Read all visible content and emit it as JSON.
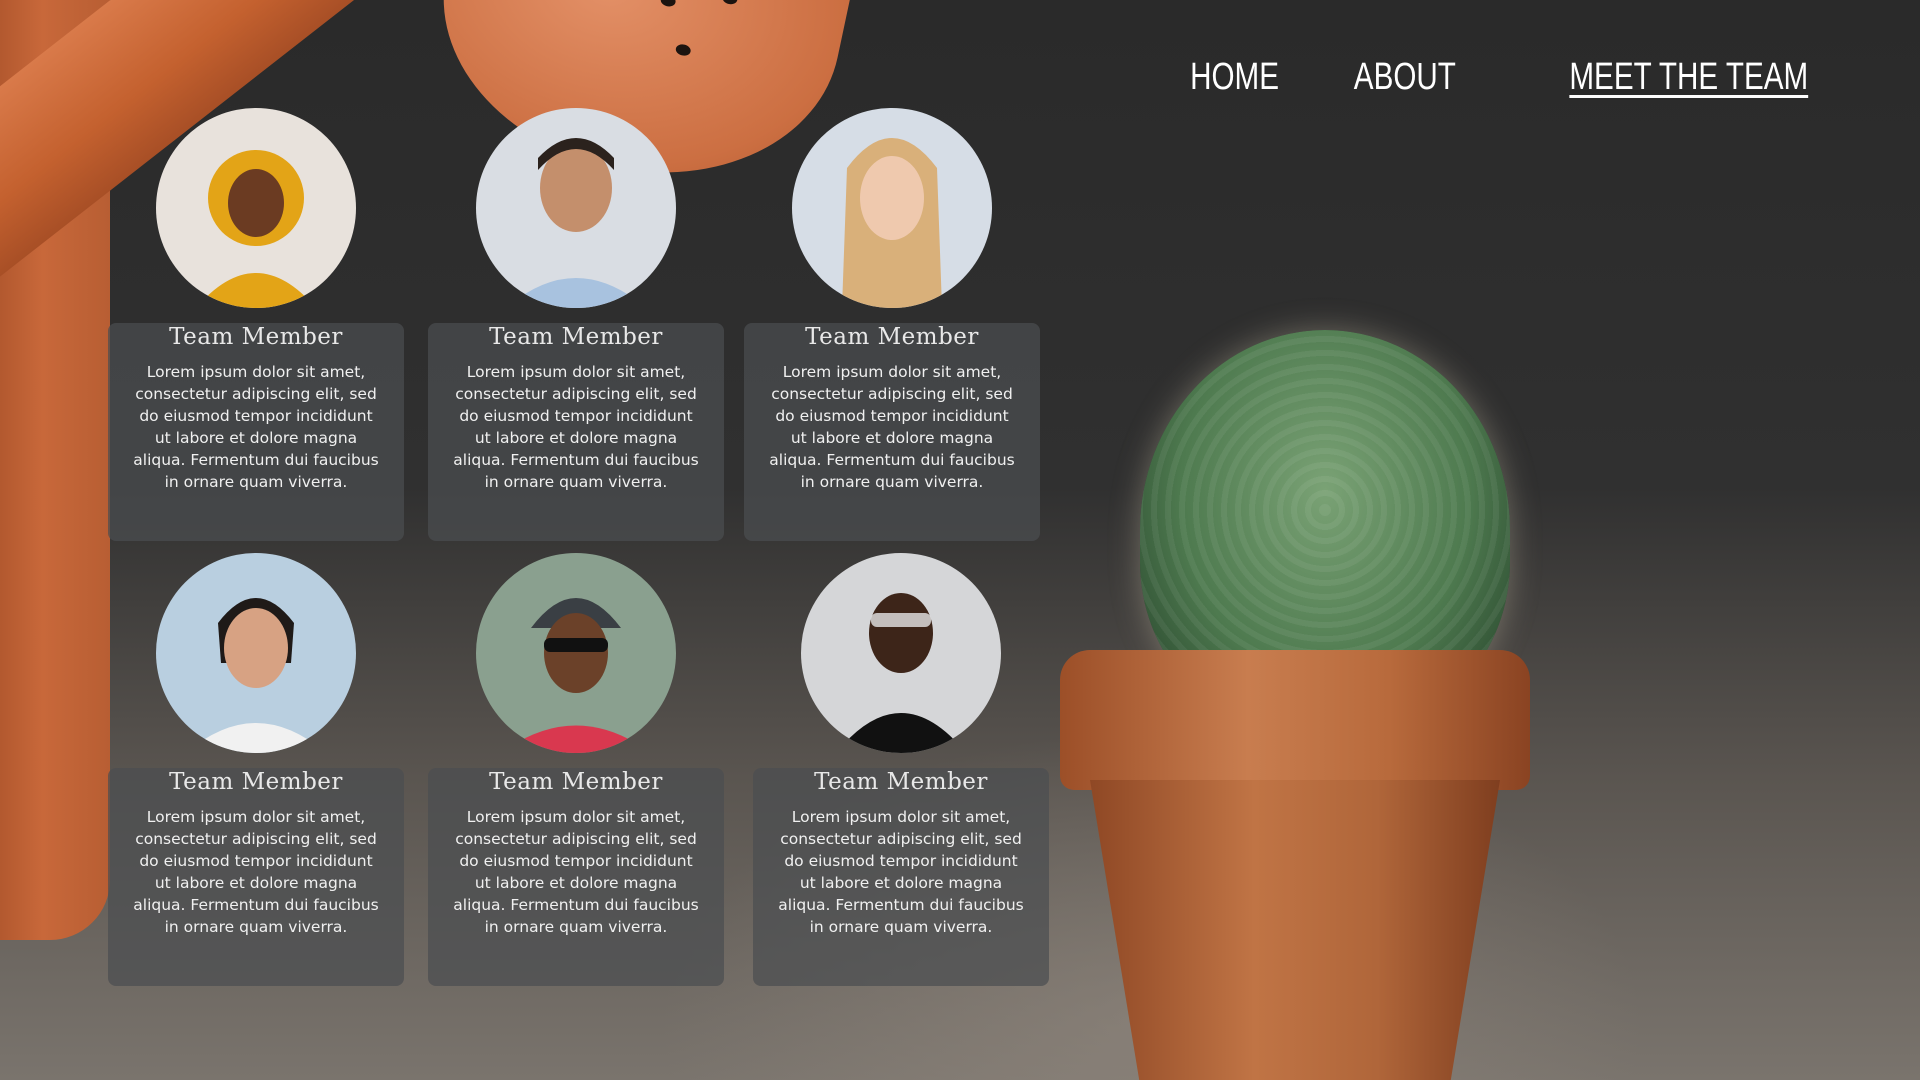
{
  "nav": {
    "items": [
      {
        "label": "HOME"
      },
      {
        "label": "ABOUT"
      },
      {
        "label": "MEET THE TEAM",
        "active": true
      }
    ]
  },
  "team": {
    "members": [
      {
        "name": "Team Member",
        "bio": "Lorem ipsum dolor sit amet, consectetur adipiscing elit, sed do eiusmod tempor incididunt ut labore et dolore magna aliqua. Fermentum dui faucibus in ornare quam viverra.",
        "photo": "person-yellow-hijab"
      },
      {
        "name": "Team Member",
        "bio": "Lorem ipsum dolor sit amet, consectetur adipiscing elit, sed do eiusmod tempor incididunt ut labore et dolore magna aliqua. Fermentum dui faucibus in ornare quam viverra.",
        "photo": "person-blue-shirt"
      },
      {
        "name": "Team Member",
        "bio": "Lorem ipsum dolor sit amet, consectetur adipiscing elit, sed do eiusmod tempor incididunt ut labore et dolore magna aliqua. Fermentum dui faucibus in ornare quam viverra.",
        "photo": "person-blonde"
      },
      {
        "name": "Team Member",
        "bio": "Lorem ipsum dolor sit amet, consectetur adipiscing elit, sed do eiusmod tempor incididunt ut labore et dolore magna aliqua. Fermentum dui faucibus in ornare quam viverra.",
        "photo": "person-white-blouse"
      },
      {
        "name": "Team Member",
        "bio": "Lorem ipsum dolor sit amet, consectetur adipiscing elit, sed do eiusmod tempor incididunt ut labore et dolore magna aliqua. Fermentum dui faucibus in ornare quam viverra.",
        "photo": "person-beanie-sunglasses"
      },
      {
        "name": "Team Member",
        "bio": "Lorem ipsum dolor sit amet, consectetur adipiscing elit, sed do eiusmod tempor incididunt ut labore et dolore magna aliqua. Fermentum dui faucibus in ornare quam viverra.",
        "photo": "person-black-turtleneck"
      }
    ]
  },
  "colors": {
    "accent_terracotta": "#c8683a",
    "card_bg": "#4b4e50",
    "text": "#ffffff"
  }
}
